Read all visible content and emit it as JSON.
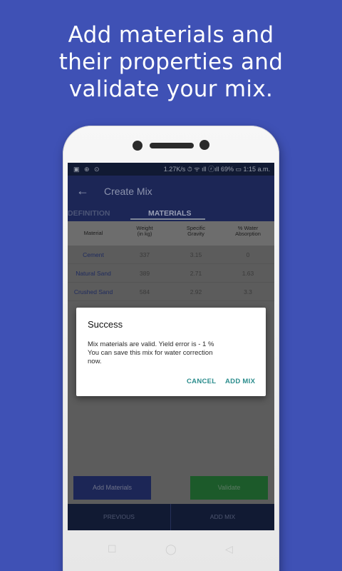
{
  "headline": {
    "line1": "Add materials and",
    "line2": "their properties and",
    "line3": "validate your mix."
  },
  "status_bar": {
    "left_icons": "▣ ⊕ ⊙",
    "right_text": "1.27K/s ⏱ ᯤ ıll ⓡıll 69% ▭ 1:15 a.m."
  },
  "toolbar": {
    "back_icon": "←",
    "title": "Create Mix"
  },
  "tabs": {
    "definition": "DEFINITION",
    "materials": "MATERIALS"
  },
  "table": {
    "headers": {
      "material": "Material",
      "weight_line1": "Weight",
      "weight_line2": "(in kg)",
      "sg_line1": "Specific",
      "sg_line2": "Gravity",
      "wa_line1": "% Water",
      "wa_line2": "Absorption"
    },
    "rows": [
      {
        "material": "Cement",
        "weight": "337",
        "sg": "3.15",
        "wa": "0"
      },
      {
        "material": "Natural Sand",
        "weight": "389",
        "sg": "2.71",
        "wa": "1.63"
      },
      {
        "material": "Crushed Sand",
        "weight": "584",
        "sg": "2.92",
        "wa": "3.3"
      }
    ]
  },
  "dialog": {
    "title": "Success",
    "message_line1": "Mix materials are valid. Yield error is  - 1 %",
    "message_line2": "You can save this mix for water correction",
    "message_line3": "now.",
    "cancel_label": "CANCEL",
    "add_mix_label": "ADD MIX"
  },
  "actions": {
    "add_materials": "Add Materials",
    "validate": "Validate"
  },
  "bottom_nav": {
    "previous": "PREVIOUS",
    "add_mix": "ADD MIX"
  },
  "softkeys": {
    "recent": "☐",
    "home": "◯",
    "back": "◁"
  }
}
